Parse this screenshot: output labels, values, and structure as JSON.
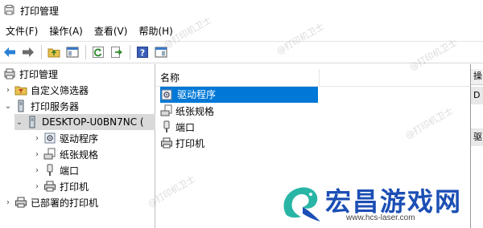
{
  "window": {
    "title": "打印管理"
  },
  "menu": [
    {
      "label": "文件(F)"
    },
    {
      "label": "操作(A)"
    },
    {
      "label": "查看(V)"
    },
    {
      "label": "帮助(H)"
    }
  ],
  "toolbar": {
    "buttons": [
      "back-icon",
      "forward-icon",
      "up-folder-icon",
      "show-hide-tree-icon",
      "refresh-icon",
      "export-icon",
      "help-icon",
      "properties-icon"
    ]
  },
  "tree": {
    "root": "打印管理",
    "custom_filters": "自定义筛选器",
    "print_servers": "打印服务器",
    "server": "DESKTOP-U0BN7NC (",
    "drivers": "驱动程序",
    "forms": "纸张规格",
    "ports": "端口",
    "printers": "打印机",
    "deployed": "已部署的打印机"
  },
  "list": {
    "header": "名称",
    "items": [
      "驱动程序",
      "纸张规格",
      "端口",
      "打印机"
    ]
  },
  "actions": {
    "header": "操",
    "item1": "D",
    "item2": "驱"
  },
  "watermark": "@打印机卫士",
  "brand": {
    "name": "宏昌游戏网",
    "url": "www.hcs-laser.com"
  },
  "colors": {
    "selection": "#0078d7",
    "brand": "#1c4fb5"
  }
}
